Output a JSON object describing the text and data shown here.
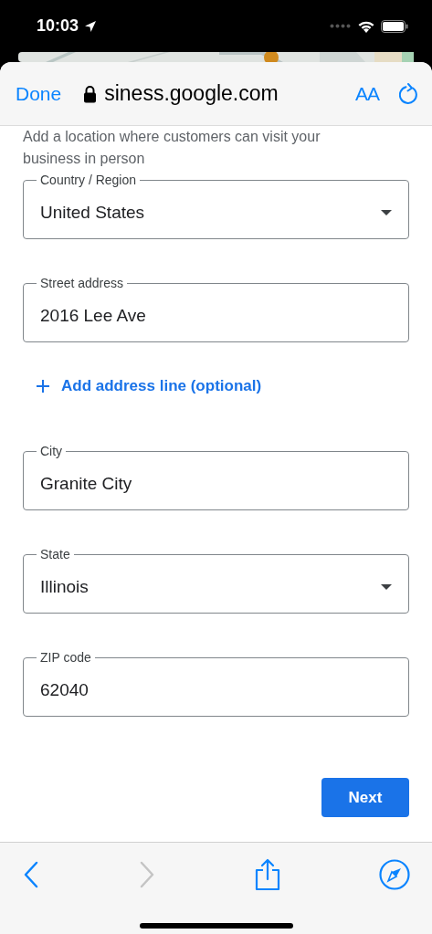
{
  "status_bar": {
    "time": "10:03"
  },
  "browser": {
    "done": "Done",
    "url": "siness.google.com",
    "text_size": "AA"
  },
  "intro": "Add a location where customers can visit your business in person",
  "fields": [
    {
      "kind": "select",
      "label": "Country / Region",
      "value": "United States"
    },
    {
      "kind": "text",
      "label": "Street address",
      "value": "2016 Lee Ave"
    },
    {
      "kind": "link",
      "label": "Add address line (optional)"
    },
    {
      "kind": "text",
      "label": "City",
      "value": "Granite City"
    },
    {
      "kind": "select",
      "label": "State",
      "value": "Illinois"
    },
    {
      "kind": "text",
      "label": "ZIP code",
      "value": "62040"
    }
  ],
  "next_button": "Next",
  "bottom_toolbar": {
    "back": {
      "disabled": false
    },
    "forward": {
      "disabled": true
    }
  }
}
